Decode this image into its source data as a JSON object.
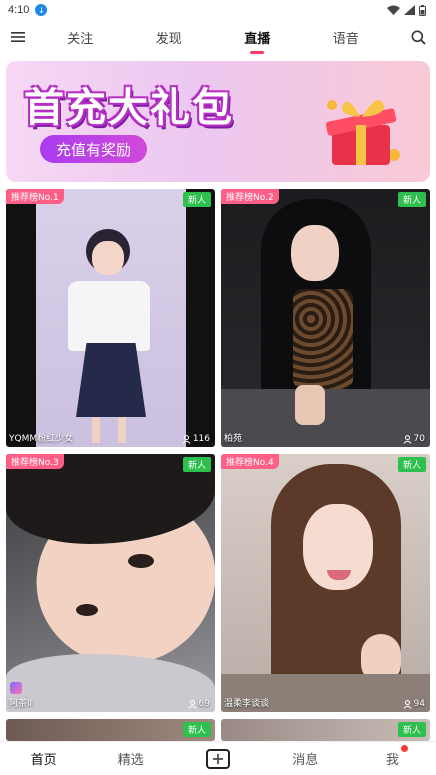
{
  "status": {
    "time": "4:10",
    "badge": "↓"
  },
  "top_nav": {
    "tabs": [
      {
        "label": "关注",
        "active": false
      },
      {
        "label": "发现",
        "active": false
      },
      {
        "label": "直播",
        "active": true
      },
      {
        "label": "语音",
        "active": false
      }
    ]
  },
  "banner": {
    "title": "首充大礼包",
    "subtitle": "充值有奖励"
  },
  "cards": [
    {
      "rank": "推荐榜No.1",
      "new_label": "新人",
      "name": "YQMM粉红少女",
      "count": "116"
    },
    {
      "rank": "推荐榜No.2",
      "new_label": "新人",
      "name": "柏苑",
      "count": "70"
    },
    {
      "rank": "推荐榜No.3",
      "new_label": "新人",
      "name": "阿茶ll",
      "count": "69"
    },
    {
      "rank": "推荐榜No.4",
      "new_label": "新人",
      "name": "温柔李谈谈",
      "count": "94"
    },
    {
      "new_label": "新人"
    },
    {
      "new_label": "新人"
    }
  ],
  "bottom_nav": {
    "items": [
      {
        "label": "首页",
        "active": true
      },
      {
        "label": "精选",
        "active": false
      },
      {
        "label": "+",
        "icon": "plus-icon"
      },
      {
        "label": "消息",
        "active": false
      },
      {
        "label": "我",
        "active": false,
        "dot": true
      }
    ]
  },
  "colors": {
    "accent": "#ff3b6b",
    "rank_badge": "#ff5f87",
    "new_badge": "#2fbf4e"
  }
}
